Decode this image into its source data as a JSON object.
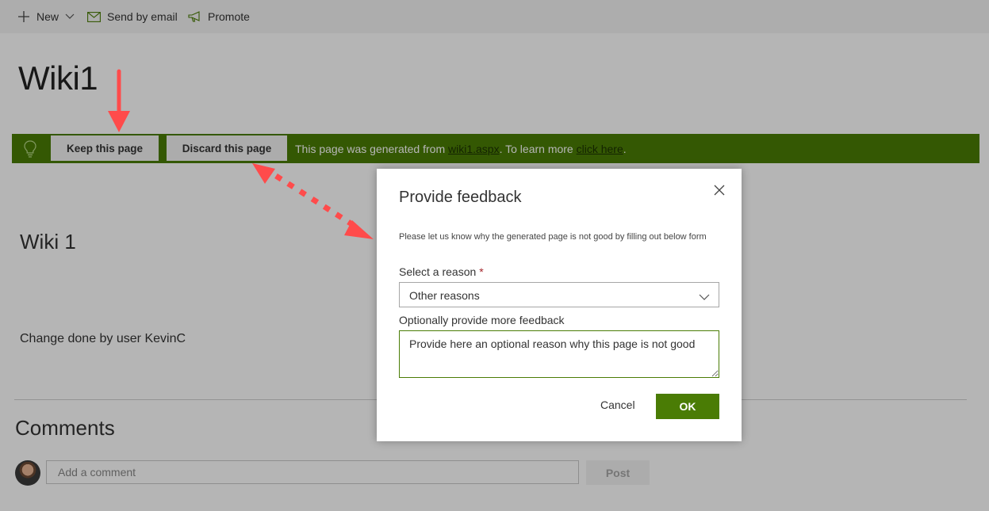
{
  "command_bar": {
    "new_label": "New",
    "send_email_label": "Send by email",
    "promote_label": "Promote",
    "icons": [
      "plus-icon",
      "chevron-down-icon",
      "mail-icon",
      "megaphone-icon"
    ]
  },
  "page": {
    "title": "Wiki1",
    "heading": "Wiki 1",
    "body_text": "Change done by user KevinC",
    "comments_heading": "Comments",
    "comment_placeholder": "Add a comment",
    "post_label": "Post"
  },
  "banner": {
    "keep_label": "Keep this page",
    "discard_label": "Discard this page",
    "text_prefix": "This page was generated from ",
    "source_link": "wiki1.aspx",
    "text_middle": ". To learn more ",
    "learn_link": "click here",
    "text_suffix": ".",
    "color": "#4a7c05",
    "icon": "lightbulb-icon"
  },
  "dialog": {
    "title": "Provide feedback",
    "description": "Please let us know why the generated page is not good by filling out below form",
    "reason_label": "Select a reason",
    "required_marker": "*",
    "reason_value": "Other reasons",
    "more_label": "Optionally provide more feedback",
    "more_value": "Provide here an optional reason why this page is not good",
    "cancel_label": "Cancel",
    "ok_label": "OK",
    "accent_color": "#4a7c05"
  },
  "annotations": {
    "arrow_color": "#ff4b4b"
  }
}
